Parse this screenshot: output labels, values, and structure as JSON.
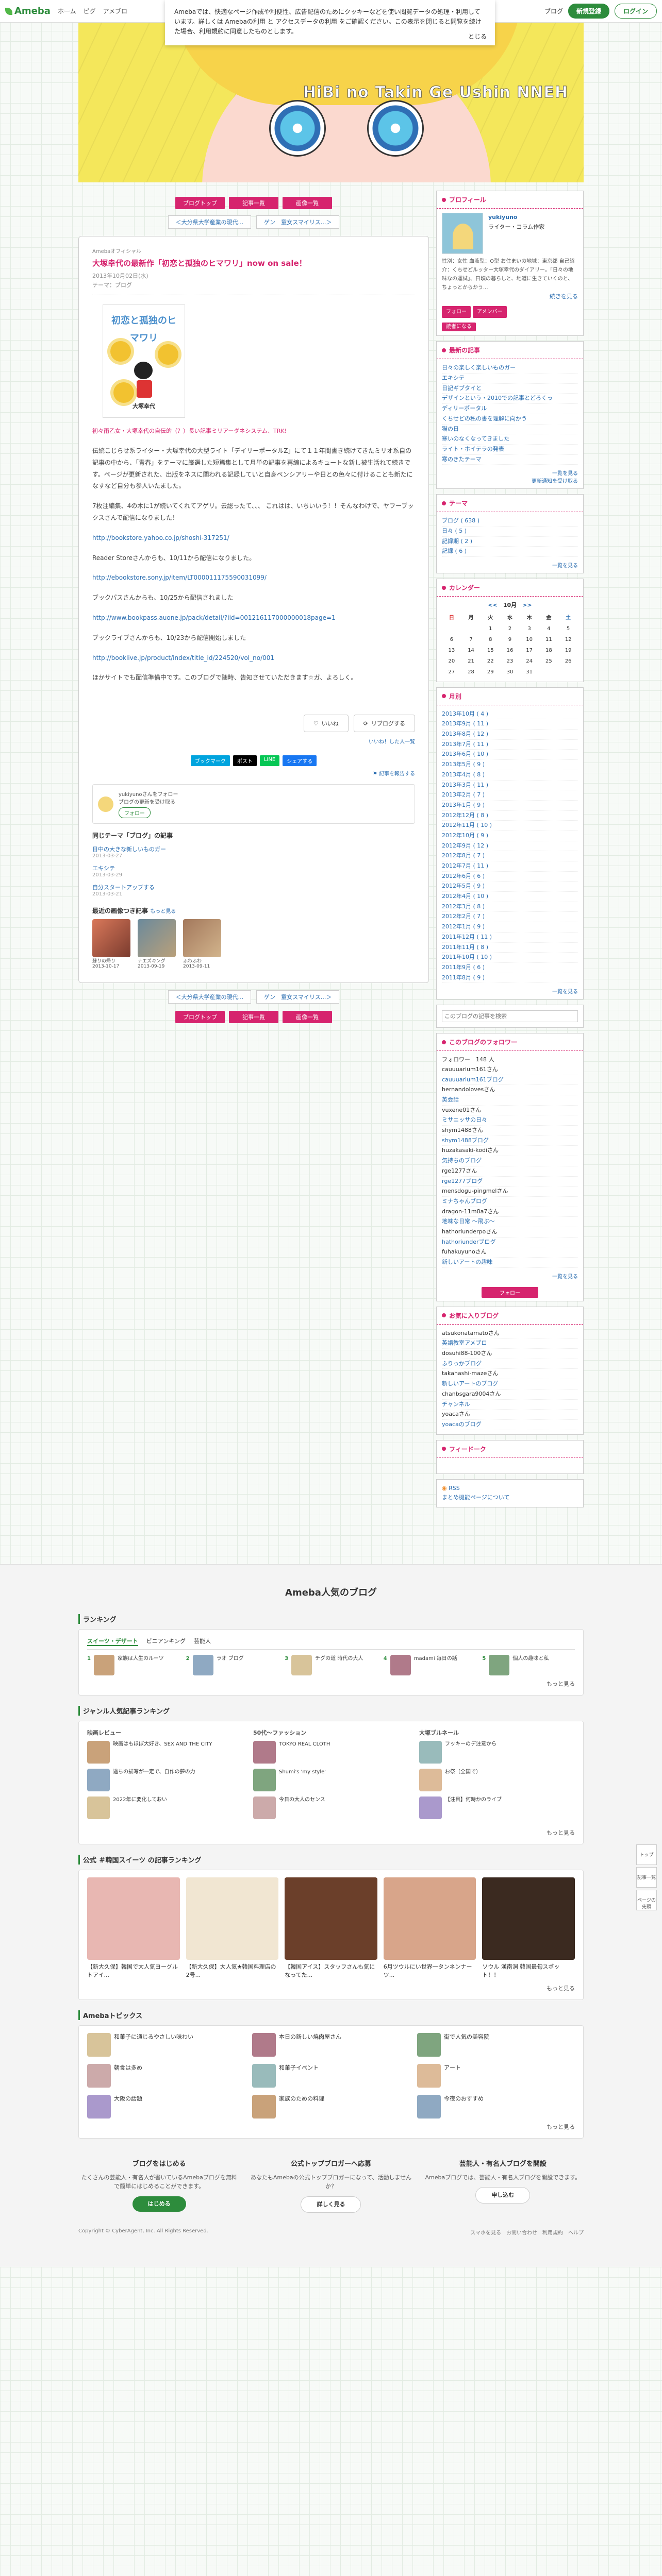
{
  "header": {
    "logo": "Ameba",
    "links": [
      "ホーム",
      "ピグ",
      "アメブロ"
    ],
    "blog_btn": "ブログ",
    "signup": "新規登録",
    "login": "ログイン"
  },
  "cookie": {
    "text": "Amebaでは、快適なページ作成や利便性、広告配信のためにクッキーなどを使い閲覧データの処理・利用しています。詳しくは Amebaの利用 と アクセスデータの利用 をご確認ください。この表示を閉じると閲覧を続けた場合、利用規約に同意したものとします。",
    "close": "とじる"
  },
  "banner": {
    "title": "HiBi no Takin Ge Ushin NNEH"
  },
  "nav": {
    "top": "ブログトップ",
    "list": "記事一覧",
    "images": "画像一覧"
  },
  "pager": {
    "prev": "＜大分県大学産業の現代...",
    "next": "ゲン　童女スマイリス...＞"
  },
  "article": {
    "tag": "Amebaオフィシャル",
    "title": "大塚幸代の最新作「初恋と孤独のヒマワリ」now on sale！",
    "date": "2013年10月02日(水)",
    "theme": "テーマ：ブログ",
    "cover_title": "初恋と孤独のヒマワリ",
    "cover_author": "大塚幸代",
    "pink_line": "初々雨乙女・大塚幸代の自伝的（？）長い記事ミリアーダネシステム、TRK!",
    "p1": "伝統こじらせ系ライター・大塚幸代の大型ライト「デイリーポータルZ」にて１１年間書き続けてきたミリオ系自の記事の中から、「青春」をテーマに厳選した短篇集として月単の記事を再編によるキュートな新し被生活れて続きです。ページが更新された、出版をネスに関われる記録していと自身ペンシアリーや日との色々に付けることも新たになすなど自分も参人いたました。",
    "p2": "7枚注編集、4の木に1が続いてくれてアゲリ。云総ったて、、、 これはは、いちいいう！！そんなわけで、ヤフーブックスさんで配信になりました！",
    "link1": "http://bookstore.yahoo.co.jp/shoshi-317251/",
    "p3": "Reader Storeさんからも、10/11から配信になりました。",
    "link2": "http://ebookstore.sony.jp/item/LT000011175590031099/",
    "p4": "ブックパスさんからも、10/25から配信されました",
    "link3": "http://www.bookpass.auone.jp/pack/detail/?iid=001216117000000018page=1",
    "p5": "ブックライブさんからも、10/23から配信開始しました",
    "link4": "http://booklive.jp/product/index/title_id/224520/vol_no/001",
    "p6": "ほかサイトでも配信準備中です。このブログで随時、告知させていただきます☆ガ、よろしく。",
    "like": "いいね",
    "reblog": "リブログする",
    "reblog_link": "いいね！した人一覧",
    "share": [
      "ブックマーク",
      "ポスト",
      "LINE",
      "シェアする"
    ],
    "report": "記事を報告する",
    "follow_card": "yukiyunoさんをフォロー",
    "follow_sub": "ブログの更新を受け取る",
    "follow_btn": "フォロー"
  },
  "same_theme": {
    "title": "同じテーマ「ブログ」の記事",
    "items": [
      {
        "title": "日中の大きな新しいものガー",
        "date": "2013-03-27"
      },
      {
        "title": "エキシテ",
        "date": "2013-03-29"
      },
      {
        "title": "自分スタートアップする",
        "date": "2013-03-21"
      }
    ],
    "more": "もっと見る"
  },
  "recent": {
    "title": "最近の画像つき記事",
    "more": "もっと見る",
    "items": [
      {
        "title": "蘇りの帰り",
        "date": "2013-10-17"
      },
      {
        "title": "ナエズキング",
        "date": "2013-09-19"
      },
      {
        "title": "ふわふわ",
        "date": "2013-09-11"
      }
    ]
  },
  "sidebar": {
    "profile": {
      "title": "プロフィール",
      "name": "yukiyuno",
      "sub": "ライター・コラム作家",
      "desc": "性別：女性 血液型：O型 お住まいの地域：東京都 自己紹介：くちせどルッター大塚幸代のダイアリー。「日々の地味なの運試」、日頃の暮らしと、地道に生きていくのと、ちょっとからかう...",
      "more": "続きを見る",
      "follow": "フォロー",
      "members": "アメンバー",
      "reader": "読者になる"
    },
    "recent_posts": {
      "title": "最新の記事",
      "items": [
        "日々の楽しく楽しいものガー",
        "エキシテ",
        "日記ギブタイと",
        "デザインという・2010での記事とどろくっ",
        "ディリーポータル",
        "くちせどの私の書を理解に向かう",
        "猫の日",
        "寒いのなくなってきました",
        "ライト・ホイテラの発表",
        "寒のきたテーマ"
      ],
      "more": "一覧を見る",
      "rss": "更新通知を受け取る"
    },
    "themes": {
      "title": "テーマ",
      "items": [
        "ブログ ( 638 )",
        "日々 ( 5 )",
        "記録期 ( 2 )",
        "記録 ( 6 )"
      ],
      "more": "一覧を見る"
    },
    "calendar": {
      "title": "カレンダー",
      "month": "10月",
      "nav_prev": "<<",
      "nav_next": ">>",
      "weekdays": [
        "日",
        "月",
        "火",
        "水",
        "木",
        "金",
        "土"
      ],
      "rows": [
        [
          "",
          "",
          "1",
          "2",
          "3",
          "4",
          "5"
        ],
        [
          "6",
          "7",
          "8",
          "9",
          "10",
          "11",
          "12"
        ],
        [
          "13",
          "14",
          "15",
          "16",
          "17",
          "18",
          "19"
        ],
        [
          "20",
          "21",
          "22",
          "23",
          "24",
          "25",
          "26"
        ],
        [
          "27",
          "28",
          "29",
          "30",
          "31",
          "",
          ""
        ]
      ]
    },
    "archive": {
      "title": "月別",
      "items": [
        "2013年10月 ( 4 )",
        "2013年9月 ( 11 )",
        "2013年8月 ( 12 )",
        "2013年7月 ( 11 )",
        "2013年6月 ( 10 )",
        "2013年5月 ( 9 )",
        "2013年4月 ( 8 )",
        "2013年3月 ( 11 )",
        "2013年2月 ( 7 )",
        "2013年1月 ( 9 )",
        "2012年12月 ( 8 )",
        "2012年11月 ( 10 )",
        "2012年10月 ( 9 )",
        "2012年9月 ( 12 )",
        "2012年8月 ( 7 )",
        "2012年7月 ( 11 )",
        "2012年6月 ( 6 )",
        "2012年5月 ( 9 )",
        "2012年4月 ( 10 )",
        "2012年3月 ( 8 )",
        "2012年2月 ( 7 )",
        "2012年1月 ( 9 )",
        "2011年12月 ( 11 )",
        "2011年11月 ( 8 )",
        "2011年10月 ( 10 )",
        "2011年9月 ( 6 )",
        "2011年8月 ( 9 )"
      ],
      "more": "一覧を見る"
    },
    "search": {
      "placeholder": "このブログの記事を検索"
    },
    "following": {
      "title": "このブログのフォロワー",
      "count": "フォロワー　148 人",
      "items": [
        {
          "name": "cauuuarium161さん",
          "blog": "cauuuarium161ブログ"
        },
        {
          "name": "hernandolovesさん",
          "blog": "英会話"
        },
        {
          "name": "vuxene01さん",
          "blog": "ミサニッサの日々"
        },
        {
          "name": "shym1488さん",
          "blog": "shym1488ブログ"
        },
        {
          "name": "huzakasaki-kodiさん",
          "blog": "気持ちのブログ"
        },
        {
          "name": "rge1277さん",
          "blog": "rge1277ブログ"
        },
        {
          "name": "mensdogu-pingmelさん",
          "blog": "ミナちゃんブログ"
        },
        {
          "name": "dragon-11m8a7さん",
          "blog": "地味な日常 ～飛ぶ～"
        },
        {
          "name": "hathoriunderpoさん",
          "blog": "hathoriunderブログ"
        },
        {
          "name": "fuhakuyunoさん",
          "blog": "新しいアートの趣味"
        }
      ],
      "more": "一覧を見る",
      "follow": "フォロー"
    },
    "favorites": {
      "title": "お気に入りブログ",
      "items": [
        {
          "name": "atsukonatamatoさん",
          "blog": "英語教室アメブロ"
        },
        {
          "name": "dosuhi88-100さん",
          "blog": "ふりっかブログ"
        },
        {
          "name": "takahashi-mazeさん",
          "blog": "新しいアートのブログ"
        },
        {
          "name": "chanbsgara9004さん",
          "blog": "チャンネル"
        },
        {
          "name": "yoacaさん",
          "blog": "yoacaのブログ"
        }
      ]
    },
    "reader_box": {
      "title": "フィードーク"
    },
    "rss_box": {
      "rss": "RSS",
      "sub": "まとめ機能ページについて"
    }
  },
  "float": {
    "top": "トップ",
    "list": "記事一覧",
    "pagetop": "ページの先頭"
  },
  "popular": {
    "title": "Ameba人気のブログ",
    "ranking": {
      "title": "ランキング",
      "tabs": [
        "スイーツ・デザート",
        "ビニアンキング",
        "芸能人"
      ],
      "items": [
        {
          "n": "1",
          "t": "家族は人生のルーツ"
        },
        {
          "n": "2",
          "t": "ラオ ブログ"
        },
        {
          "n": "3",
          "t": "チグの道 時代の大人"
        },
        {
          "n": "4",
          "t": "madami 毎日の話"
        },
        {
          "n": "5",
          "t": "個人の趣味と私"
        }
      ]
    },
    "genre": {
      "title": "ジャンル人気記事ランキング",
      "cols": [
        {
          "h": "映画レビュー",
          "items": [
            "映画はもほぼ大好き、SEX AND THE CITY",
            "過ちの描写が一定で、自作の夢の力",
            "2022年に変化しておい"
          ]
        },
        {
          "h": "50代～ファッション",
          "items": [
            "TOKYO REAL CLOTH",
            "Shumi's 'my style'",
            "今日の大人のセンス"
          ]
        },
        {
          "h": "大塚ブルネール",
          "items": [
            "フッキーのデ注意から",
            "お祭（全国で）",
            "【注目】何時かのライブ"
          ]
        }
      ]
    },
    "sweets": {
      "title": "公式 ＃韓国スイーツ の記事ランキング",
      "items": [
        "【新大久保】韓国で大人気ヨーグルトアイ...",
        "【新大久保】大人気★韓国料理店の2号...",
        "【韓国アイス】スタッフさんも気になってた...",
        "6月ツウルにい世界一タンネンナーツ...",
        "ソウル 漢南洞 韓国最旬スポット！！"
      ]
    },
    "topics": {
      "title": "Amebaトピックス",
      "items": [
        "和菓子に通じるやさしい味わい",
        "本日の新しい焼肉屋さん",
        "街で人気の美容院",
        "朝食は多め",
        "和菓子イベント",
        "アート",
        "大阪の話題",
        "家族のための料理",
        "今夜のおすすめ"
      ]
    },
    "more": "もっと見る",
    "cta": [
      {
        "h": "ブログをはじめる",
        "d": "たくさんの芸能人・有名人が書いているAmebaブログを無料で簡単にはじめることができます。",
        "b": "はじめる"
      },
      {
        "h": "公式トップブロガーへ応募",
        "d": "あなたもAmebaの公式トップブロガーになって、活動しませんか？",
        "b": "詳しく見る"
      },
      {
        "h": "芸能人・有名人ブログを開設",
        "d": "Amebaブログでは、芸能人・有名人ブログを開設できます。",
        "b": "申し込む"
      }
    ],
    "footer_left": "スマホを見る　お問い合わせ　利用規約　ヘルプ",
    "footer_right": "Copyright © CyberAgent, Inc. All Rights Reserved."
  }
}
